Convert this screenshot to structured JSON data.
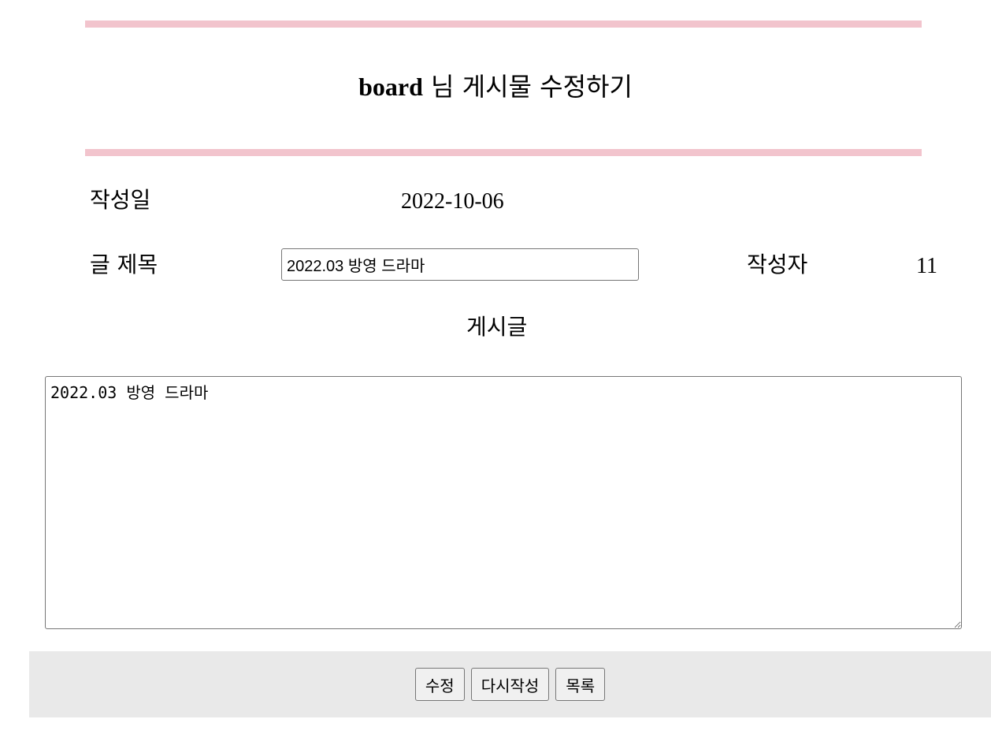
{
  "header": {
    "user": "board",
    "title_suffix": "님 게시물 수정하기"
  },
  "form": {
    "date_label": "작성일",
    "date_value": "2022-10-06",
    "title_label": "글 제목",
    "title_value": "2022.03 방영 드라마",
    "author_label": "작성자",
    "author_value": "11",
    "content_label": "게시글",
    "content_value": "2022.03 방영 드라마"
  },
  "buttons": {
    "edit": "수정",
    "reset": "다시작성",
    "list": "목록"
  },
  "colors": {
    "rule": "#f2c4cd",
    "footer_bg": "#e9e9e9"
  }
}
